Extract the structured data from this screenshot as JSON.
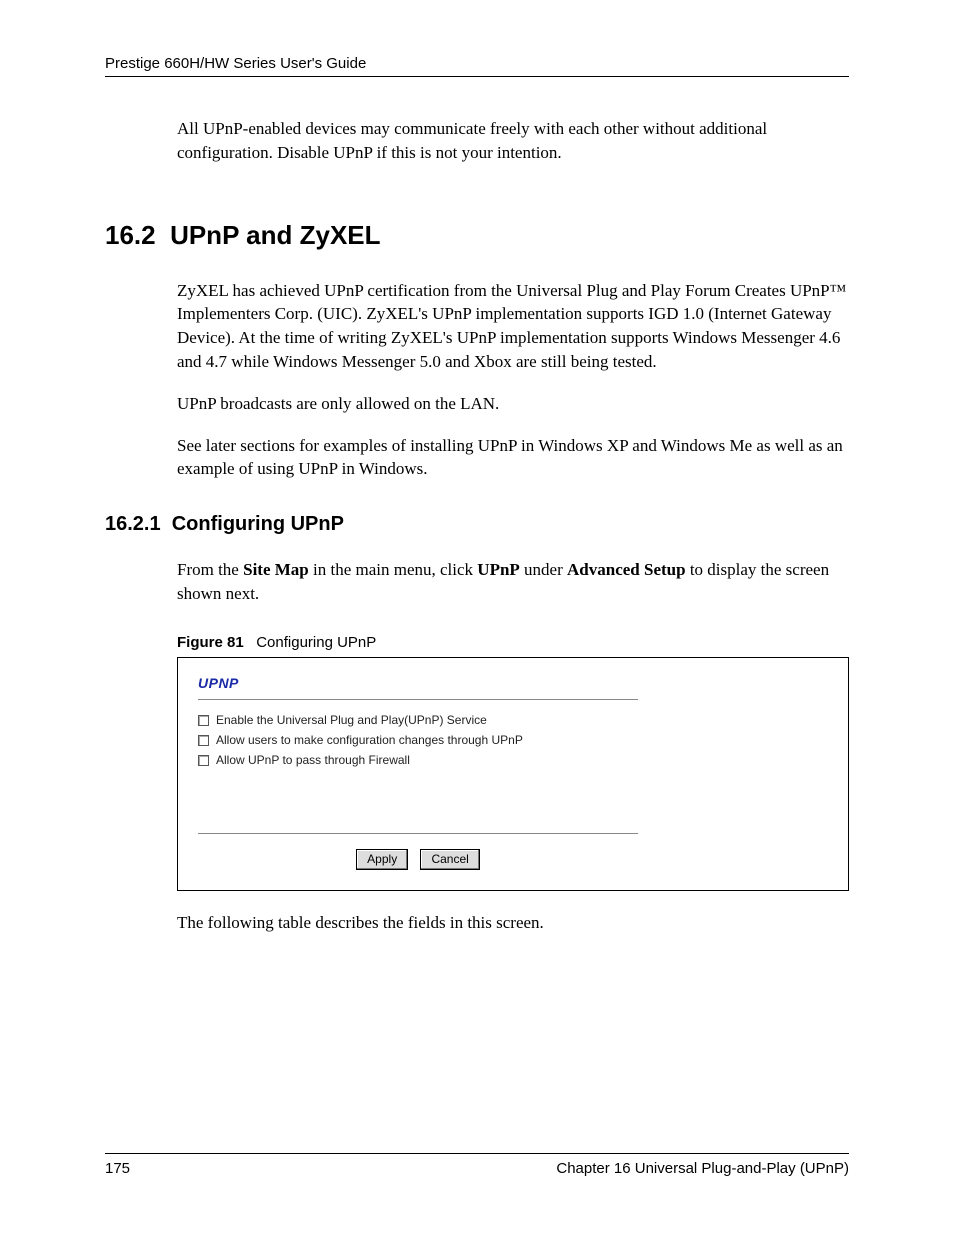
{
  "header": {
    "title": "Prestige 660H/HW Series User's Guide"
  },
  "intro_para": "All UPnP-enabled devices may communicate freely with each other without additional configuration. Disable UPnP if this is not your intention.",
  "section": {
    "number": "16.2",
    "title": "UPnP and ZyXEL",
    "para1": "ZyXEL has achieved UPnP certification from the Universal Plug and Play Forum Creates UPnP™ Implementers Corp. (UIC). ZyXEL's UPnP implementation supports IGD 1.0 (Internet Gateway Device). At the time of writing ZyXEL's UPnP implementation supports Windows Messenger 4.6 and 4.7 while Windows Messenger 5.0 and Xbox are still being tested.",
    "para2": "UPnP broadcasts are only allowed on the LAN.",
    "para3": "See later sections for examples of installing UPnP in Windows XP and Windows Me as well as an example of using UPnP in Windows."
  },
  "subsection": {
    "number": "16.2.1",
    "title": "Configuring UPnP",
    "intro_prefix": "From the ",
    "intro_bold1": "Site Map",
    "intro_mid1": " in the main menu, click ",
    "intro_bold2": "UPnP",
    "intro_mid2": " under ",
    "intro_bold3": "Advanced Setup",
    "intro_suffix": " to display the screen shown next."
  },
  "figure": {
    "label": "Figure 81",
    "caption": "Configuring UPnP",
    "panel_title": "UPNP",
    "options": [
      "Enable the Universal Plug and Play(UPnP) Service",
      "Allow users to make configuration changes through UPnP",
      "Allow UPnP to pass through Firewall"
    ],
    "apply": "Apply",
    "cancel": "Cancel"
  },
  "after_figure": "The following table describes the fields in this screen.",
  "footer": {
    "page": "175",
    "chapter": "Chapter 16 Universal Plug-and-Play (UPnP)"
  }
}
